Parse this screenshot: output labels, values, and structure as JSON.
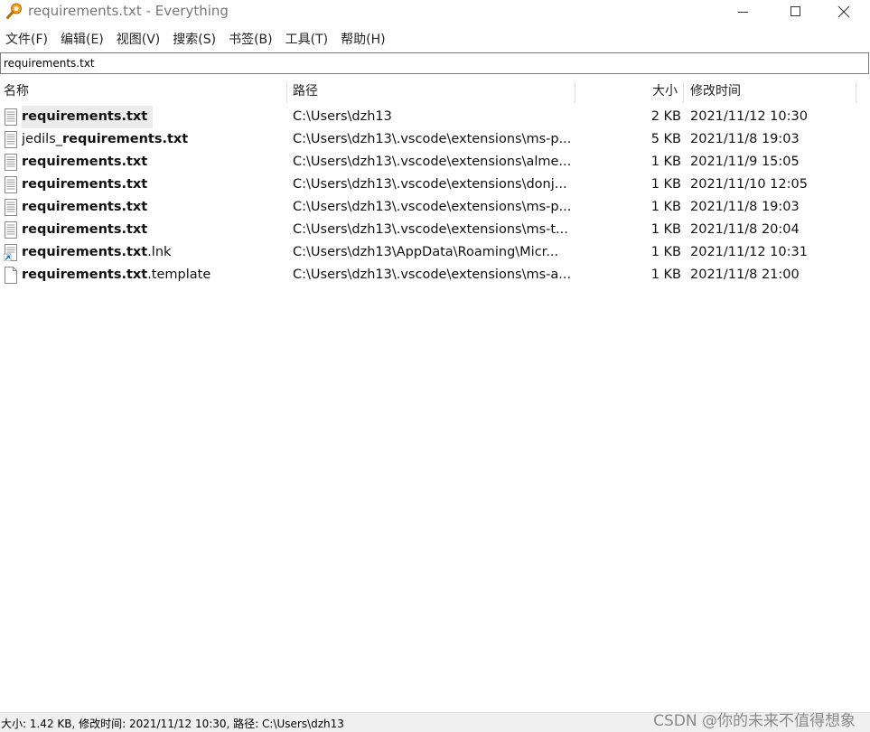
{
  "window": {
    "title": "requirements.txt - Everything",
    "icon": "search-key-icon",
    "controls": [
      "minimize-icon",
      "maximize-icon",
      "close-icon"
    ]
  },
  "menu": [
    {
      "label": "文件(F)"
    },
    {
      "label": "编辑(E)"
    },
    {
      "label": "视图(V)"
    },
    {
      "label": "搜索(S)"
    },
    {
      "label": "书签(B)"
    },
    {
      "label": "工具(T)"
    },
    {
      "label": "帮助(H)"
    }
  ],
  "search": {
    "value": "requirements.txt"
  },
  "columns": {
    "name": "名称",
    "path": "路径",
    "size": "大小",
    "modified": "修改时间"
  },
  "results": [
    {
      "pre": "",
      "match": "requirements.txt",
      "post": "",
      "path": "C:\\Users\\dzh13",
      "size": "2 KB",
      "modified": "2021/11/12 10:30",
      "icon": "text-file-icon",
      "selected": true
    },
    {
      "pre": "jedils_",
      "match": "requirements.txt",
      "post": "",
      "path": "C:\\Users\\dzh13\\.vscode\\extensions\\ms-p...",
      "size": "5 KB",
      "modified": "2021/11/8 19:03",
      "icon": "text-file-icon"
    },
    {
      "pre": "",
      "match": "requirements.txt",
      "post": "",
      "path": "C:\\Users\\dzh13\\.vscode\\extensions\\alme...",
      "size": "1 KB",
      "modified": "2021/11/9 15:05",
      "icon": "text-file-icon"
    },
    {
      "pre": "",
      "match": "requirements.txt",
      "post": "",
      "path": "C:\\Users\\dzh13\\.vscode\\extensions\\donj...",
      "size": "1 KB",
      "modified": "2021/11/10 12:05",
      "icon": "text-file-icon"
    },
    {
      "pre": "",
      "match": "requirements.txt",
      "post": "",
      "path": "C:\\Users\\dzh13\\.vscode\\extensions\\ms-p...",
      "size": "1 KB",
      "modified": "2021/11/8 19:03",
      "icon": "text-file-icon"
    },
    {
      "pre": "",
      "match": "requirements.txt",
      "post": "",
      "path": "C:\\Users\\dzh13\\.vscode\\extensions\\ms-t...",
      "size": "1 KB",
      "modified": "2021/11/8 20:04",
      "icon": "text-file-icon"
    },
    {
      "pre": "",
      "match": "requirements.txt",
      "post": ".lnk",
      "path": "C:\\Users\\dzh13\\AppData\\Roaming\\Micr...",
      "size": "1 KB",
      "modified": "2021/11/12 10:31",
      "icon": "shortcut-file-icon"
    },
    {
      "pre": "",
      "match": "requirements.txt",
      "post": ".template",
      "path": "C:\\Users\\dzh13\\.vscode\\extensions\\ms-a...",
      "size": "1 KB",
      "modified": "2021/11/8 21:00",
      "icon": "blank-file-icon"
    }
  ],
  "status": {
    "text": "大小: 1.42 KB, 修改时间: 2021/11/12 10:30, 路径: C:\\Users\\dzh13"
  },
  "watermark": "CSDN @你的未来不值得想象"
}
